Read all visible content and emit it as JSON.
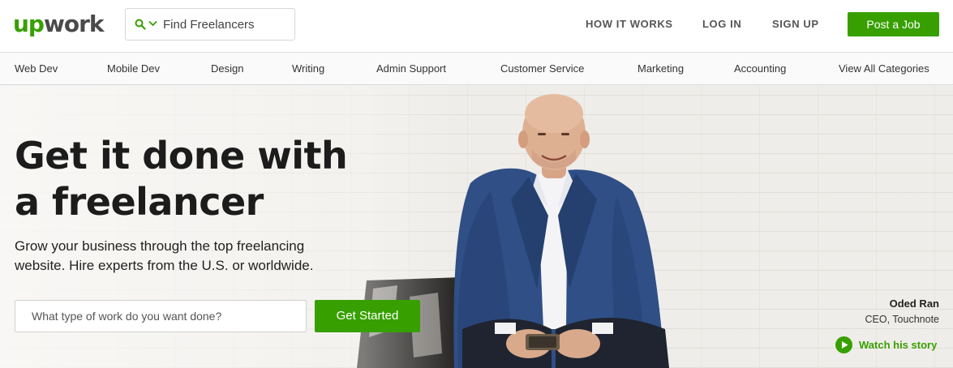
{
  "header": {
    "logo_accent": "up",
    "logo_rest": "work",
    "search_placeholder": "Find Freelancers",
    "nav": [
      "HOW IT WORKS",
      "LOG IN",
      "SIGN UP"
    ],
    "post_job": "Post a Job"
  },
  "categories": [
    "Web Dev",
    "Mobile Dev",
    "Design",
    "Writing",
    "Admin Support",
    "Customer Service",
    "Marketing",
    "Accounting",
    "View All Categories"
  ],
  "hero": {
    "headline_line1": "Get it done with",
    "headline_line2": "a freelancer",
    "sub_line1": "Grow your business through the top freelancing",
    "sub_line2": "website. Hire experts from the U.S. or worldwide.",
    "input_placeholder": "What type of work do you want done?",
    "cta": "Get Started",
    "person_name": "Oded Ran",
    "person_title": "CEO, Touchnote",
    "watch_label": "Watch his story"
  },
  "colors": {
    "brand_green": "#37a000",
    "text_dark": "#1c1c1c"
  },
  "icons": [
    "search-icon",
    "chevron-down-icon",
    "play-icon"
  ]
}
